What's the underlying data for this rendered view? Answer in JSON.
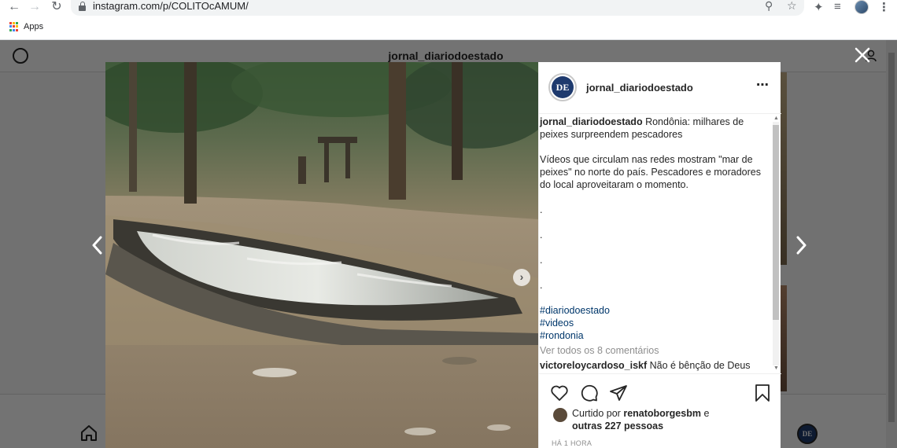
{
  "browser": {
    "url": "instagram.com/p/COLITOcAMUM/",
    "bookmarks": [
      {
        "label": "Apps"
      }
    ]
  },
  "page": {
    "header_title": "jornal_diariodoestado"
  },
  "post": {
    "author": "jornal_diariodoestado",
    "avatar_text": "DE",
    "caption_headline": "Rondônia: milhares de peixes surpreendem pescadores",
    "caption_body": "Vídeos que circulam nas redes mostram \"mar de peixes\" no norte do país. Pescadores e moradores do local aproveitaram o momento.",
    "caption_dots": [
      ".",
      ".",
      ".",
      "."
    ],
    "hashtags": [
      "#diariodoestado",
      "#videos",
      "#rondonia"
    ],
    "view_comments": "Ver todos os 8 comentários",
    "comment": {
      "user": "victoreloycardoso_iskf",
      "text": "Não é bênção de Deus"
    },
    "likes_prefix": "Curtido por",
    "likes_user": "renatoborgesbm",
    "likes_suffix": "e",
    "likes_others": "outras 227 pessoas",
    "timestamp": "HÁ 1 HORA"
  },
  "colors": {
    "hashtag": "#00376b",
    "overlay": "rgba(0,0,0,0.55)",
    "avatar_bg": "#1e3a6e"
  }
}
